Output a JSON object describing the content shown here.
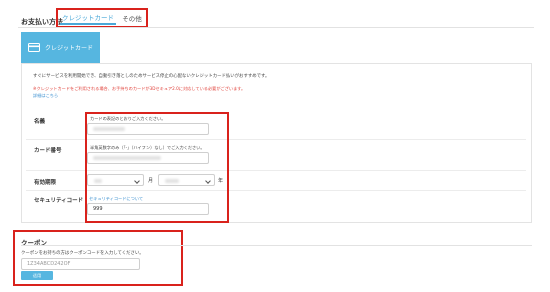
{
  "payment": {
    "label": "お支払い方法",
    "tabs": [
      {
        "label": "クレジットカード",
        "active": true
      },
      {
        "label": "その他",
        "active": false
      }
    ],
    "card_button_label": "クレジットカード"
  },
  "notice": {
    "intro": "すぐにサービスを利用開始でき、自動引き落としのためサービス停止の心配ないクレジットカード払いがおすすめです。",
    "warning": "※クレジットカードをご利用される場合、お手持ちのカードが3Dセキュア2.0に対応している必要がございます。",
    "link": "詳細はこちら"
  },
  "form": {
    "name": {
      "label": "名義",
      "hint": "カードの表記のとおりご入力ください。"
    },
    "number": {
      "label": "カード番号",
      "hint": "半角英数字のみ（「-」（ハイフン）なし）でご入力ください。"
    },
    "expiry": {
      "label": "有効期限",
      "month_unit": "月",
      "year_unit": "年"
    },
    "cvc": {
      "label": "セキュリティコード",
      "link": "セキュリティコードについて",
      "value": "999"
    }
  },
  "coupon": {
    "title": "クーポン",
    "description": "クーポンをお持ちの方はクーポンコードを入力してください。",
    "placeholder": "1Z34ABCD242OF",
    "apply_label": "适用"
  },
  "colors": {
    "accent": "#56b6e0",
    "highlight": "#d9221c",
    "warning": "#e0413a",
    "link": "#3a8fd0"
  }
}
